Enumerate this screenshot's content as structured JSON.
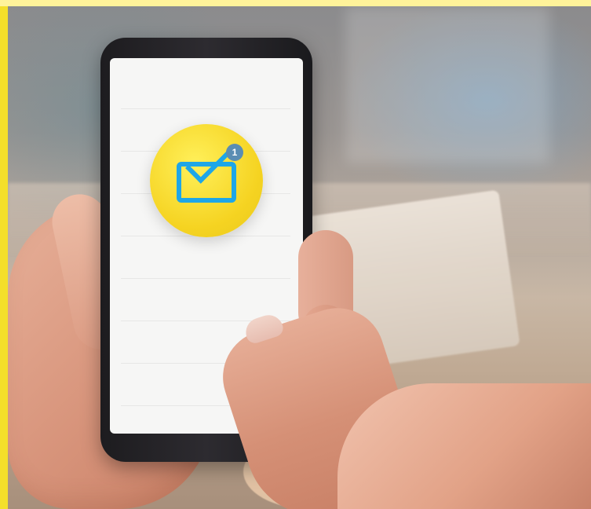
{
  "notification": {
    "count": "1",
    "icon": "envelope-icon",
    "badge_color": "#f5d321",
    "icon_color": "#1ea6e7",
    "bubble_color": "#5a8db3"
  }
}
